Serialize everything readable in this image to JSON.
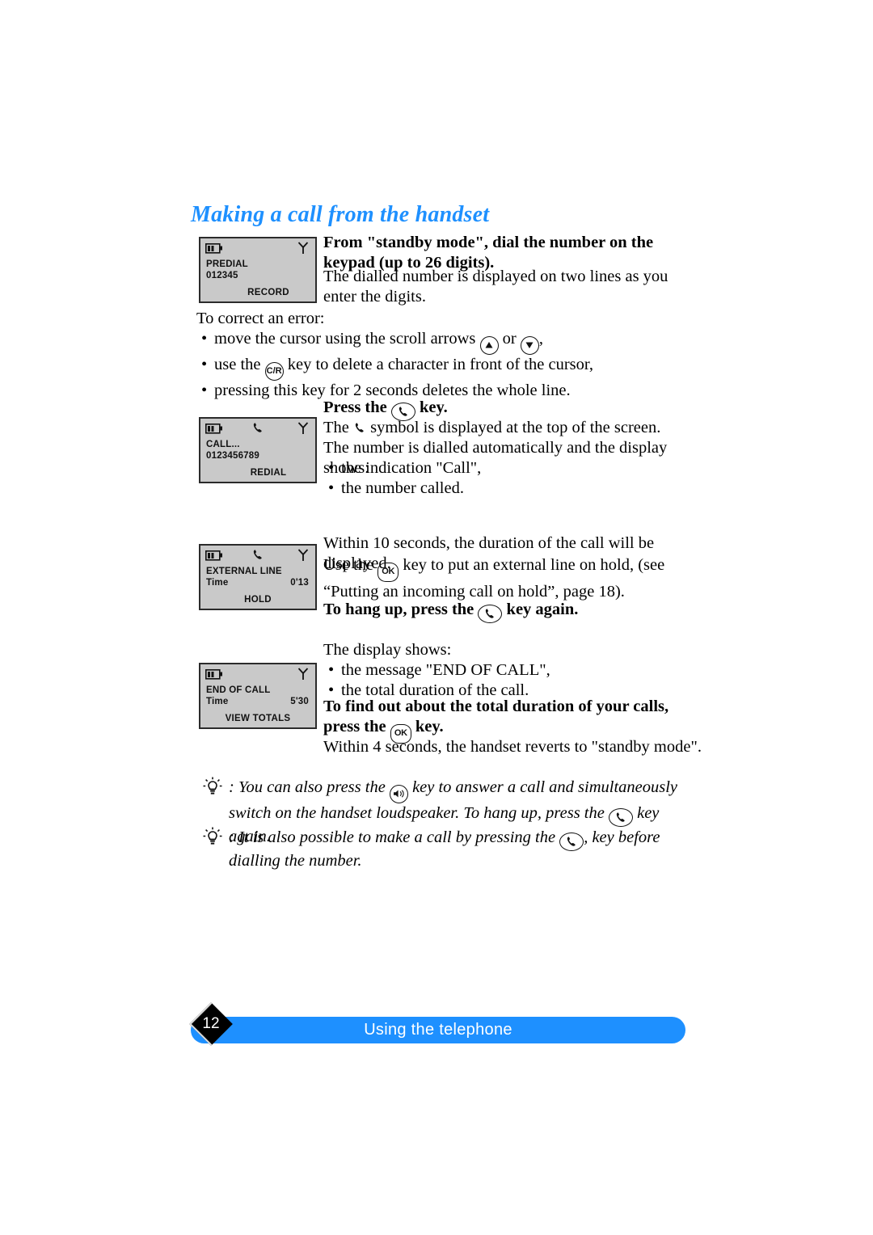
{
  "heading": "Making a call from the handset",
  "sections": {
    "s1": {
      "lcd": {
        "line1": "PREDIAL",
        "line2": "012345",
        "line2_right": "",
        "softkey": "RECORD",
        "battery_icon": "battery-icon",
        "antenna_icon": "antenna-icon",
        "phone_icon": ""
      },
      "bold": "From \"standby mode\", dial the number on the keypad (up to 26 digits).",
      "body": "The dialled number is displayed on two lines as you enter the digits."
    },
    "correct": {
      "intro": "To correct an error:",
      "b1_a": "move the cursor using the scroll arrows",
      "b1_mid": "or",
      "b1_end": ",",
      "b2_a": "use the",
      "b2_key": "C/R",
      "b2_b": "key to delete a character in front of the cursor,",
      "b3": "pressing this key for 2 seconds deletes the whole line."
    },
    "s2": {
      "lcd": {
        "line1": "CALL...",
        "line2": "0123456789",
        "line2_right": "",
        "softkey": "REDIAL",
        "battery_icon": "battery-icon",
        "antenna_icon": "antenna-icon",
        "phone_icon": "phone-icon"
      },
      "bold_a": "Press the",
      "bold_b": "key.",
      "body1_a": "The",
      "body1_b": "symbol is displayed at the top of the screen.",
      "body2": "The number is dialled automatically and the display shows:",
      "b1": "the indication \"Call\",",
      "b2": "the number called."
    },
    "s3": {
      "lcd": {
        "line1": "EXTERNAL LINE",
        "line2": "Time",
        "line2_right": "0'13",
        "softkey": "HOLD",
        "battery_icon": "battery-icon",
        "antenna_icon": "antenna-icon",
        "phone_icon": "phone-icon"
      },
      "body1": "Within 10 seconds, the duration of the call will be displayed.",
      "body2_a": "Use the",
      "ok_key": "OK",
      "body2_b": "key to put an external line on hold, (see “Putting an incoming call on hold”, page 18).",
      "bold_a": "To hang up, press the",
      "bold_b": "key again."
    },
    "s4": {
      "lcd": {
        "line1": "END OF CALL",
        "line2": "Time",
        "line2_right": "5'30",
        "softkey": "VIEW TOTALS",
        "battery_icon": "battery-icon",
        "antenna_icon": "antenna-icon",
        "phone_icon": ""
      },
      "body1": "The display shows:",
      "b1": "the message  \"END OF CALL\",",
      "b2": "the total duration of the call.",
      "bold_a": "To find out about the total duration of your calls, press the",
      "ok_key": "OK",
      "bold_b": "key.",
      "body2": "Within 4 seconds, the handset reverts to \"standby mode\"."
    }
  },
  "tips": [
    {
      "colon": ":",
      "part_a": "You can also press the",
      "part_b": "key to answer a call and simultaneously switch on the handset loudspeaker. To hang up, press the",
      "part_c": "key again."
    },
    {
      "colon": ":",
      "part_a": "It is also possible to make a call by pressing the",
      "part_b": ", key before dialling the",
      "part_c": "number."
    }
  ],
  "footer": {
    "page_number": "12",
    "label": "Using the telephone",
    "accent_color": "#1e90ff"
  }
}
